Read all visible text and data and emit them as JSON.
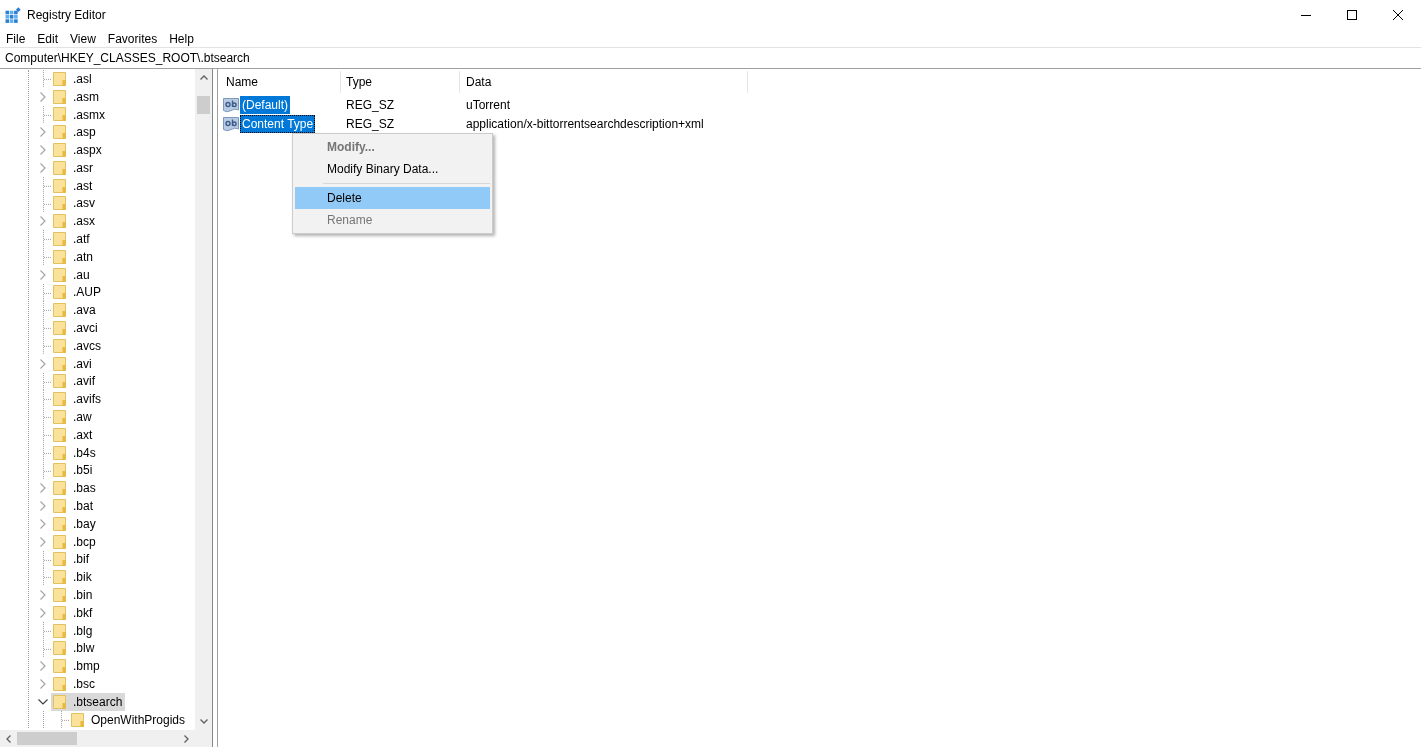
{
  "window": {
    "title": "Registry Editor"
  },
  "menu_bar": [
    "File",
    "Edit",
    "View",
    "Favorites",
    "Help"
  ],
  "address_bar": {
    "value": "Computer\\HKEY_CLASSES_ROOT\\.btsearch"
  },
  "tree": {
    "items": [
      {
        "label": ".asl",
        "selected": false
      },
      {
        "label": ".asm",
        "expanded": false,
        "selected": false
      },
      {
        "label": ".asmx",
        "selected": false
      },
      {
        "label": ".asp",
        "expanded": false,
        "selected": false
      },
      {
        "label": ".aspx",
        "expanded": false,
        "selected": false
      },
      {
        "label": ".asr",
        "expanded": false,
        "selected": false
      },
      {
        "label": ".ast",
        "selected": false
      },
      {
        "label": ".asv",
        "selected": false
      },
      {
        "label": ".asx",
        "expanded": false,
        "selected": false
      },
      {
        "label": ".atf",
        "selected": false
      },
      {
        "label": ".atn",
        "selected": false
      },
      {
        "label": ".au",
        "expanded": false,
        "selected": false
      },
      {
        "label": ".AUP",
        "selected": false
      },
      {
        "label": ".ava",
        "selected": false
      },
      {
        "label": ".avci",
        "selected": false
      },
      {
        "label": ".avcs",
        "selected": false
      },
      {
        "label": ".avi",
        "expanded": false,
        "selected": false
      },
      {
        "label": ".avif",
        "selected": false
      },
      {
        "label": ".avifs",
        "selected": false
      },
      {
        "label": ".aw",
        "selected": false
      },
      {
        "label": ".axt",
        "selected": false
      },
      {
        "label": ".b4s",
        "selected": false
      },
      {
        "label": ".b5i",
        "selected": false
      },
      {
        "label": ".bas",
        "expanded": false,
        "selected": false
      },
      {
        "label": ".bat",
        "expanded": false,
        "selected": false
      },
      {
        "label": ".bay",
        "expanded": false,
        "selected": false
      },
      {
        "label": ".bcp",
        "expanded": false,
        "selected": false
      },
      {
        "label": ".bif",
        "selected": false
      },
      {
        "label": ".bik",
        "selected": false
      },
      {
        "label": ".bin",
        "expanded": false,
        "selected": false
      },
      {
        "label": ".bkf",
        "expanded": false,
        "selected": false
      },
      {
        "label": ".blg",
        "selected": false
      },
      {
        "label": ".blw",
        "selected": false
      },
      {
        "label": ".bmp",
        "expanded": false,
        "selected": false
      },
      {
        "label": ".bsc",
        "expanded": false,
        "selected": false
      },
      {
        "label": ".btsearch",
        "expanded": true,
        "selected": true,
        "children": [
          {
            "label": "OpenWithProgids",
            "selected": false
          }
        ]
      }
    ]
  },
  "values_list": {
    "columns": [
      "Name",
      "Type",
      "Data"
    ],
    "rows": [
      {
        "name": "(Default)",
        "type": "REG_SZ",
        "data": "uTorrent",
        "selected": true,
        "focused": false
      },
      {
        "name": "Content Type",
        "type": "REG_SZ",
        "data": "application/x-bittorrentsearchdescription+xml",
        "selected": true,
        "focused": true
      }
    ]
  },
  "context_menu": {
    "groups": [
      {
        "items": [
          {
            "label": "Modify...",
            "default": true,
            "disabled": true,
            "selected": false
          },
          {
            "label": "Modify Binary Data...",
            "default": false,
            "disabled": false,
            "selected": false
          }
        ]
      },
      {
        "items": [
          {
            "label": "Delete",
            "default": false,
            "disabled": false,
            "selected": true
          },
          {
            "label": "Rename",
            "default": false,
            "disabled": true,
            "selected": false
          }
        ]
      }
    ]
  }
}
